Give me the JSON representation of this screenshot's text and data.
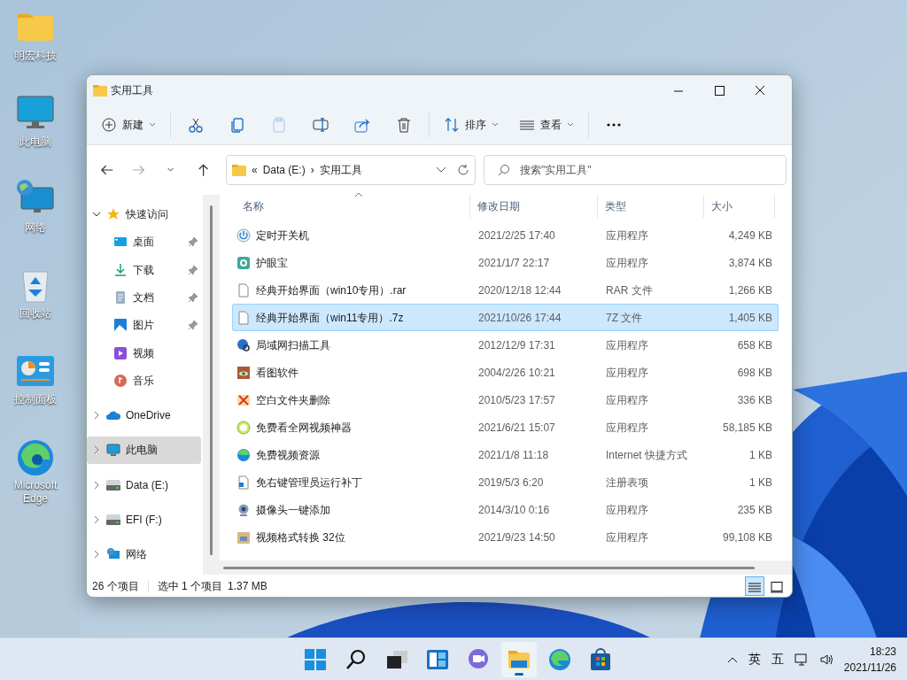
{
  "desktop_icons": [
    {
      "label": "明宏科技",
      "kind": "folder"
    },
    {
      "label": "此电脑",
      "kind": "monitor"
    },
    {
      "label": "网络",
      "kind": "network"
    },
    {
      "label": "回收站",
      "kind": "recycle"
    },
    {
      "label": "控制面板",
      "kind": "control"
    },
    {
      "label": "Microsoft Edge",
      "kind": "edge"
    }
  ],
  "window": {
    "title": "实用工具"
  },
  "toolbar": [
    {
      "kind": "new",
      "label": "新建",
      "disabled": false
    },
    {
      "kind": "cut",
      "disabled": false
    },
    {
      "kind": "copy",
      "disabled": false
    },
    {
      "kind": "paste",
      "disabled": true
    },
    {
      "kind": "rename",
      "disabled": false
    },
    {
      "kind": "share",
      "disabled": false
    },
    {
      "kind": "delete",
      "disabled": false
    },
    {
      "kind": "sort",
      "label": "排序",
      "disabled": false
    },
    {
      "kind": "view",
      "label": "查看",
      "disabled": false
    },
    {
      "kind": "more",
      "disabled": false
    }
  ],
  "nav": {
    "back_disabled": false,
    "forward_disabled": true
  },
  "address": {
    "breadcrumb": [
      "«",
      "Data (E:)",
      "›",
      "实用工具"
    ]
  },
  "search": {
    "placeholder": "搜索\"实用工具\""
  },
  "sidebar": {
    "items": [
      {
        "label": "快速访问",
        "kind": "star",
        "expanded": true,
        "selected": false,
        "children": [
          {
            "label": "桌面",
            "kind": "desktop",
            "pinned": true,
            "selected": false
          },
          {
            "label": "下载",
            "kind": "download",
            "pinned": true,
            "selected": false
          },
          {
            "label": "文档",
            "kind": "document",
            "pinned": true,
            "selected": false
          },
          {
            "label": "图片",
            "kind": "pictures",
            "pinned": true,
            "selected": false
          },
          {
            "label": "视频",
            "kind": "videos",
            "pinned": false,
            "selected": false
          },
          {
            "label": "音乐",
            "kind": "music",
            "pinned": false,
            "selected": false
          }
        ]
      },
      {
        "label": "OneDrive",
        "kind": "cloud",
        "expanded": false,
        "selected": false
      },
      {
        "label": "此电脑",
        "kind": "monitor",
        "expanded": false,
        "selected": true
      },
      {
        "label": "Data (E:)",
        "kind": "drive",
        "expanded": false,
        "selected": false
      },
      {
        "label": "EFI (F:)",
        "kind": "drive",
        "expanded": false,
        "selected": false
      },
      {
        "label": "网络",
        "kind": "network",
        "expanded": false,
        "selected": false
      }
    ]
  },
  "table": {
    "columns": [
      {
        "label": "名称",
        "sorted": true
      },
      {
        "label": "修改日期",
        "sorted": false
      },
      {
        "label": "类型",
        "sorted": false
      },
      {
        "label": "大小",
        "sorted": false
      }
    ],
    "rows": [
      {
        "name": "定时开关机",
        "date": "2021/2/25 17:40",
        "type": "应用程序",
        "size": "4,249 KB",
        "kind": "power",
        "selected": false
      },
      {
        "name": "护眼宝",
        "date": "2021/1/7 22:17",
        "type": "应用程序",
        "size": "3,874 KB",
        "kind": "eye",
        "selected": false
      },
      {
        "name": "经典开始界面（win10专用）.rar",
        "date": "2020/12/18 12:44",
        "type": "RAR 文件",
        "size": "1,266 KB",
        "kind": "file",
        "selected": false
      },
      {
        "name": "经典开始界面（win11专用）.7z",
        "date": "2021/10/26 17:44",
        "type": "7Z 文件",
        "size": "1,405 KB",
        "kind": "file",
        "selected": true
      },
      {
        "name": "局域网扫描工具",
        "date": "2012/12/9 17:31",
        "type": "应用程序",
        "size": "658 KB",
        "kind": "scan",
        "selected": false
      },
      {
        "name": "看图软件",
        "date": "2004/2/26 10:21",
        "type": "应用程序",
        "size": "698 KB",
        "kind": "viewer",
        "selected": false
      },
      {
        "name": "空白文件夹删除",
        "date": "2010/5/23 17:57",
        "type": "应用程序",
        "size": "336 KB",
        "kind": "cross",
        "selected": false
      },
      {
        "name": "免费看全网视频神器",
        "date": "2021/6/21 15:07",
        "type": "应用程序",
        "size": "58,185 KB",
        "kind": "video",
        "selected": false
      },
      {
        "name": "免费视频资源",
        "date": "2021/1/8 11:18",
        "type": "Internet 快捷方式",
        "size": "1 KB",
        "kind": "edge",
        "selected": false
      },
      {
        "name": "免右键管理员运行补丁",
        "date": "2019/5/3 6:20",
        "type": "注册表项",
        "size": "1 KB",
        "kind": "reg",
        "selected": false
      },
      {
        "name": "摄像头一键添加",
        "date": "2014/3/10 0:16",
        "type": "应用程序",
        "size": "235 KB",
        "kind": "camera",
        "selected": false
      },
      {
        "name": "视频格式转换 32位",
        "date": "2021/9/23 14:50",
        "type": "应用程序",
        "size": "99,108 KB",
        "kind": "package",
        "selected": false
      }
    ]
  },
  "status_bar": {
    "count": "26 个项目",
    "selection": "选中 1 个项目",
    "selection_size": "1.37 MB",
    "views": [
      {
        "kind": "details",
        "selected": true
      },
      {
        "kind": "tiles",
        "selected": false
      }
    ]
  },
  "taskbar": {
    "apps": [
      {
        "kind": "start",
        "active": false
      },
      {
        "kind": "search",
        "active": false
      },
      {
        "kind": "taskview",
        "active": false
      },
      {
        "kind": "widgets",
        "active": false
      },
      {
        "kind": "chat",
        "active": false
      },
      {
        "kind": "explorer",
        "active": true
      },
      {
        "kind": "edge",
        "active": false
      },
      {
        "kind": "store",
        "active": false
      }
    ],
    "tray": {
      "language": "英",
      "ime": "五",
      "time": "18:23",
      "date": "2021/11/26"
    }
  }
}
